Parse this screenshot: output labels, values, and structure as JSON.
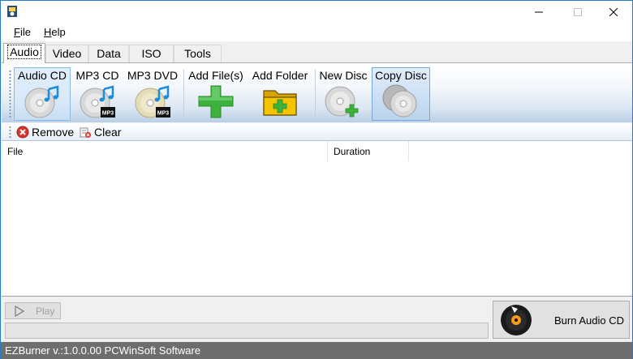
{
  "window": {
    "title": ""
  },
  "menu": {
    "file": "File",
    "file_accel": "F",
    "file_rest": "ile",
    "help": "Help",
    "help_accel": "H",
    "help_rest": "elp"
  },
  "tabs": [
    {
      "label": "Audio",
      "active": true
    },
    {
      "label": "Video",
      "active": false
    },
    {
      "label": "Data",
      "active": false
    },
    {
      "label": "ISO",
      "active": false
    },
    {
      "label": "Tools",
      "active": false
    }
  ],
  "ribbon": {
    "audio_cd": "Audio CD",
    "mp3_cd": "MP3 CD",
    "mp3_dvd": "MP3 DVD",
    "add_files": "Add File(s)",
    "add_folder": "Add Folder",
    "new_disc": "New Disc",
    "copy_disc": "Copy Disc",
    "mp3_badge": "MP3"
  },
  "subtoolbar": {
    "remove": "Remove",
    "clear": "Clear"
  },
  "list": {
    "columns": [
      "File",
      "Duration"
    ]
  },
  "controls": {
    "play": "Play",
    "burn": "Burn Audio CD",
    "progress": 0
  },
  "status": {
    "text": "EZBurner v.:1.0.0.00 PCWinSoft Software"
  },
  "colors": {
    "accent": "#2b78c8",
    "status_bg": "#6e6e6e",
    "plus_green": "#3cb13c",
    "folder_yellow": "#f5c400",
    "remove_red": "#d9342b"
  }
}
